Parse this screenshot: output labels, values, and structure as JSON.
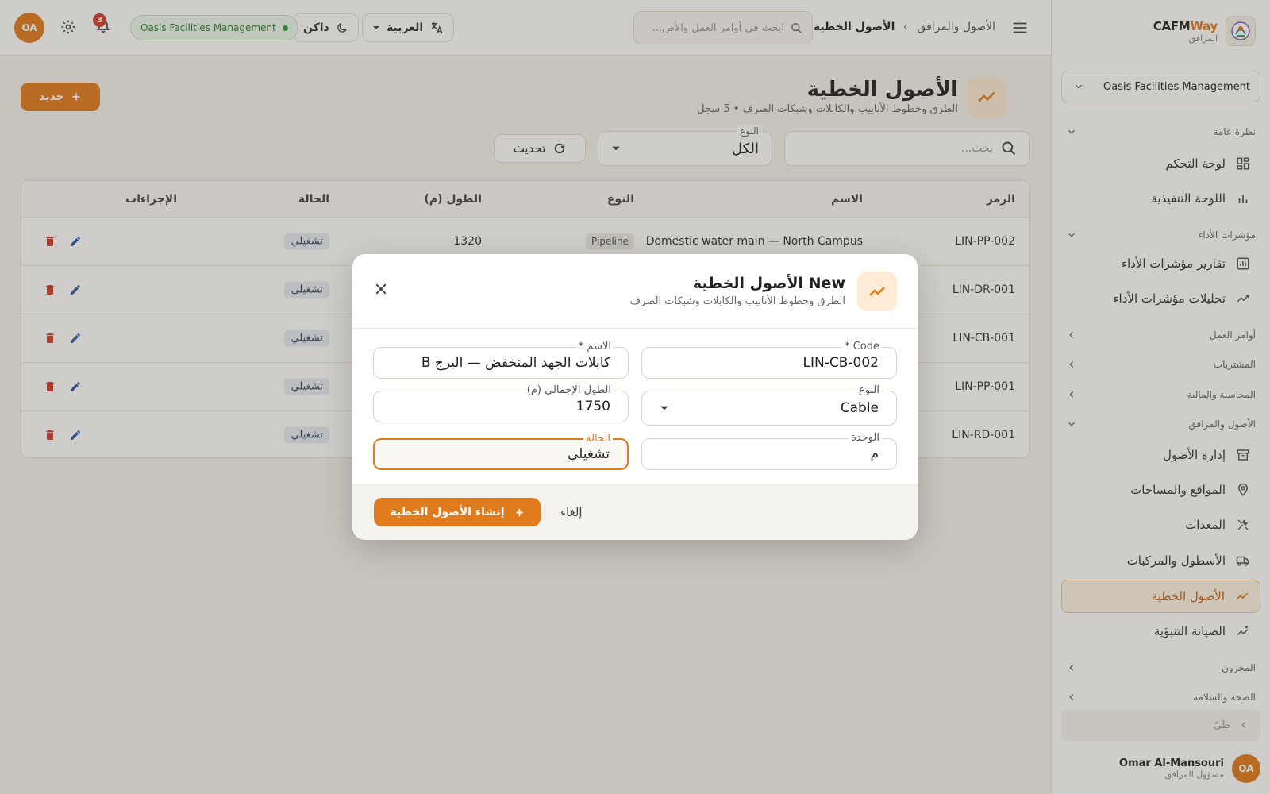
{
  "brand": {
    "name_a": "CAFM",
    "name_b": "Way",
    "sub": "المرافق"
  },
  "org": {
    "name": "Oasis Facilities Management"
  },
  "sidebar": {
    "sections": {
      "overview": "نظرة عامة",
      "kpi": "مؤشرات الأداء",
      "workorders": "أوامر العمل",
      "procurement": "المشتريات",
      "finance": "المحاسبة والمالية",
      "assets": "الأصول والمرافق",
      "inventory": "المخزون",
      "hse": "الصحة والسلامة"
    },
    "items": {
      "dashboard": "لوحة التحكم",
      "executive": "اللوحة التنفيذية",
      "kpi_reports": "تقارير مؤشرات الأداء",
      "kpi_analytics": "تحليلات مؤشرات الأداء",
      "asset_mgmt": "إدارة الأصول",
      "locations": "المواقع والمساحات",
      "equipment": "المعدات",
      "fleet": "الأسطول والمركبات",
      "linear": "الأصول الخطية",
      "predictive": "الصيانة التنبؤية"
    },
    "collapse": "طيّ"
  },
  "user": {
    "initials": "OA",
    "name": "Omar Al-Mansouri",
    "role": "مسؤول المرافق"
  },
  "topbar": {
    "breadcrumb": {
      "parent": "الأصول والمرافق",
      "current": "الأصول الخطية"
    },
    "search_placeholder": "ابحث في أوامر العمل والأص...",
    "language": "العربية",
    "theme": "داكن",
    "org_pill": "Oasis Facilities Management",
    "notifications": "3",
    "avatar": "OA"
  },
  "page": {
    "title": "الأصول الخطية",
    "subtitle": "الطرق وخطوط الأنابيب والكابلات وشبكات الصرف",
    "records": "5 سجل",
    "new_button": "جديد",
    "search_placeholder": "بحث...",
    "type_label": "النوع",
    "type_value": "الكل",
    "refresh": "تحديث"
  },
  "table": {
    "headers": {
      "code": "الرمز",
      "name": "الاسم",
      "type": "النوع",
      "length": "الطول (م)",
      "status": "الحالة",
      "actions": "الإجراءات"
    },
    "rows": [
      {
        "code": "LIN-PP-002",
        "name": "Domestic water main — North Campus",
        "type": "Pipeline",
        "length": "1320",
        "status": "تشغيلي"
      },
      {
        "code": "LIN-DR-001",
        "name": "",
        "type": "",
        "length": "",
        "status": "تشغيلي"
      },
      {
        "code": "LIN-CB-001",
        "name": "",
        "type": "",
        "length": "",
        "status": "تشغيلي"
      },
      {
        "code": "LIN-PP-001",
        "name": "",
        "type": "",
        "length": "",
        "status": "تشغيلي"
      },
      {
        "code": "LIN-RD-001",
        "name": "",
        "type": "",
        "length": "",
        "status": "تشغيلي"
      }
    ]
  },
  "modal": {
    "title": "New الأصول الخطية",
    "subtitle": "الطرق وخطوط الأنابيب والكابلات وشبكات الصرف",
    "fields": {
      "code": {
        "label": "Code *",
        "value": "LIN-CB-002"
      },
      "name": {
        "label": "الاسم *",
        "value": "كابلات الجهد المنخفض — البرج B"
      },
      "type": {
        "label": "النوع",
        "value": "Cable"
      },
      "total_length": {
        "label": "الطول الإجمالي (م)",
        "value": "1750"
      },
      "unit": {
        "label": "الوحدة",
        "value": "م"
      },
      "status": {
        "label": "الحالة",
        "value": "تشغيلي"
      }
    },
    "create": "إنشاء الأصول الخطية",
    "cancel": "إلغاء"
  },
  "colors": {
    "accent": "#e07b1d",
    "danger": "#d63a2f",
    "success": "#2f9e44",
    "status_chip": "#e6ebf3"
  }
}
